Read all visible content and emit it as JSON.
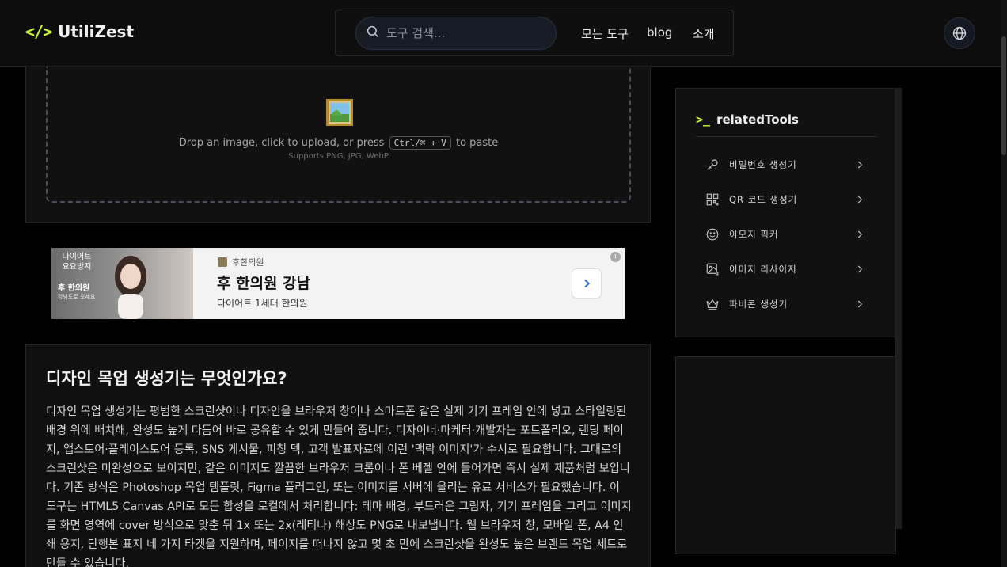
{
  "header": {
    "logo_mark": "</>",
    "logo_text": "UtiliZest",
    "search_placeholder": "도구 검색...",
    "nav": [
      "모든 도구",
      "blog",
      "소개"
    ]
  },
  "upload": {
    "drop_text_before": "Drop an image, click to upload, or press",
    "shortcut": "Ctrl/⌘ + V",
    "drop_text_after": "to paste",
    "supports": "Supports PNG, JPG, WebP"
  },
  "ad": {
    "left_tag": "다이어트 요요방지",
    "left_name": "후 한의원",
    "left_small": "강남도로 오세요",
    "brand": "후한의원",
    "title": "후 한의원 강남",
    "subtitle": "다이어트 1세대 한의원",
    "info": "i"
  },
  "article": {
    "heading": "디자인 목업 생성기는 무엇인가요?",
    "body": "디자인 목업 생성기는 평범한 스크린샷이나 디자인을 브라우저 창이나 스마트폰 같은 실제 기기 프레임 안에 넣고 스타일링된 배경 위에 배치해, 완성도 높게 다듬어 바로 공유할 수 있게 만들어 줍니다. 디자이너·마케터·개발자는 포트폴리오, 랜딩 페이지, 앱스토어·플레이스토어 등록, SNS 게시물, 피칭 덱, 고객 발표자료에 이런 '맥락 이미지'가 수시로 필요합니다. 그대로의 스크린샷은 미완성으로 보이지만, 같은 이미지도 깔끔한 브라우저 크롬이나 폰 베젤 안에 들어가면 즉시 실제 제품처럼 보입니다. 기존 방식은 Photoshop 목업 템플릿, Figma 플러그인, 또는 이미지를 서버에 올리는 유료 서비스가 필요했습니다. 이 도구는 HTML5 Canvas API로 모든 합성을 로컬에서 처리합니다: 테마 배경, 부드러운 그림자, 기기 프레임을 그리고 이미지를 화면 영역에 cover 방식으로 맞춘 뒤 1x 또는 2x(레티나) 해상도 PNG로 내보냅니다. 웹 브라우저 창, 모바일 폰, A4 인쇄 용지, 단행본 표지 네 가지 타겟을 지원하며, 페이지를 떠나지 않고 몇 초 만에 스크린샷을 완성도 높은 브랜드 목업 세트로 만들 수 있습니다."
  },
  "sidebar": {
    "prompt": ">_",
    "title": "relatedTools",
    "items": [
      {
        "label": "비밀번호 생성기",
        "icon": "key-icon"
      },
      {
        "label": "QR 코드 생성기",
        "icon": "qr-code-icon"
      },
      {
        "label": "이모지 픽커",
        "icon": "smiley-icon"
      },
      {
        "label": "이미지 리사이저",
        "icon": "image-resize-icon"
      },
      {
        "label": "파비콘 생성기",
        "icon": "crown-icon"
      }
    ]
  },
  "colors": {
    "accent": "#c7f33a",
    "background": "#000000",
    "card": "#111111"
  }
}
